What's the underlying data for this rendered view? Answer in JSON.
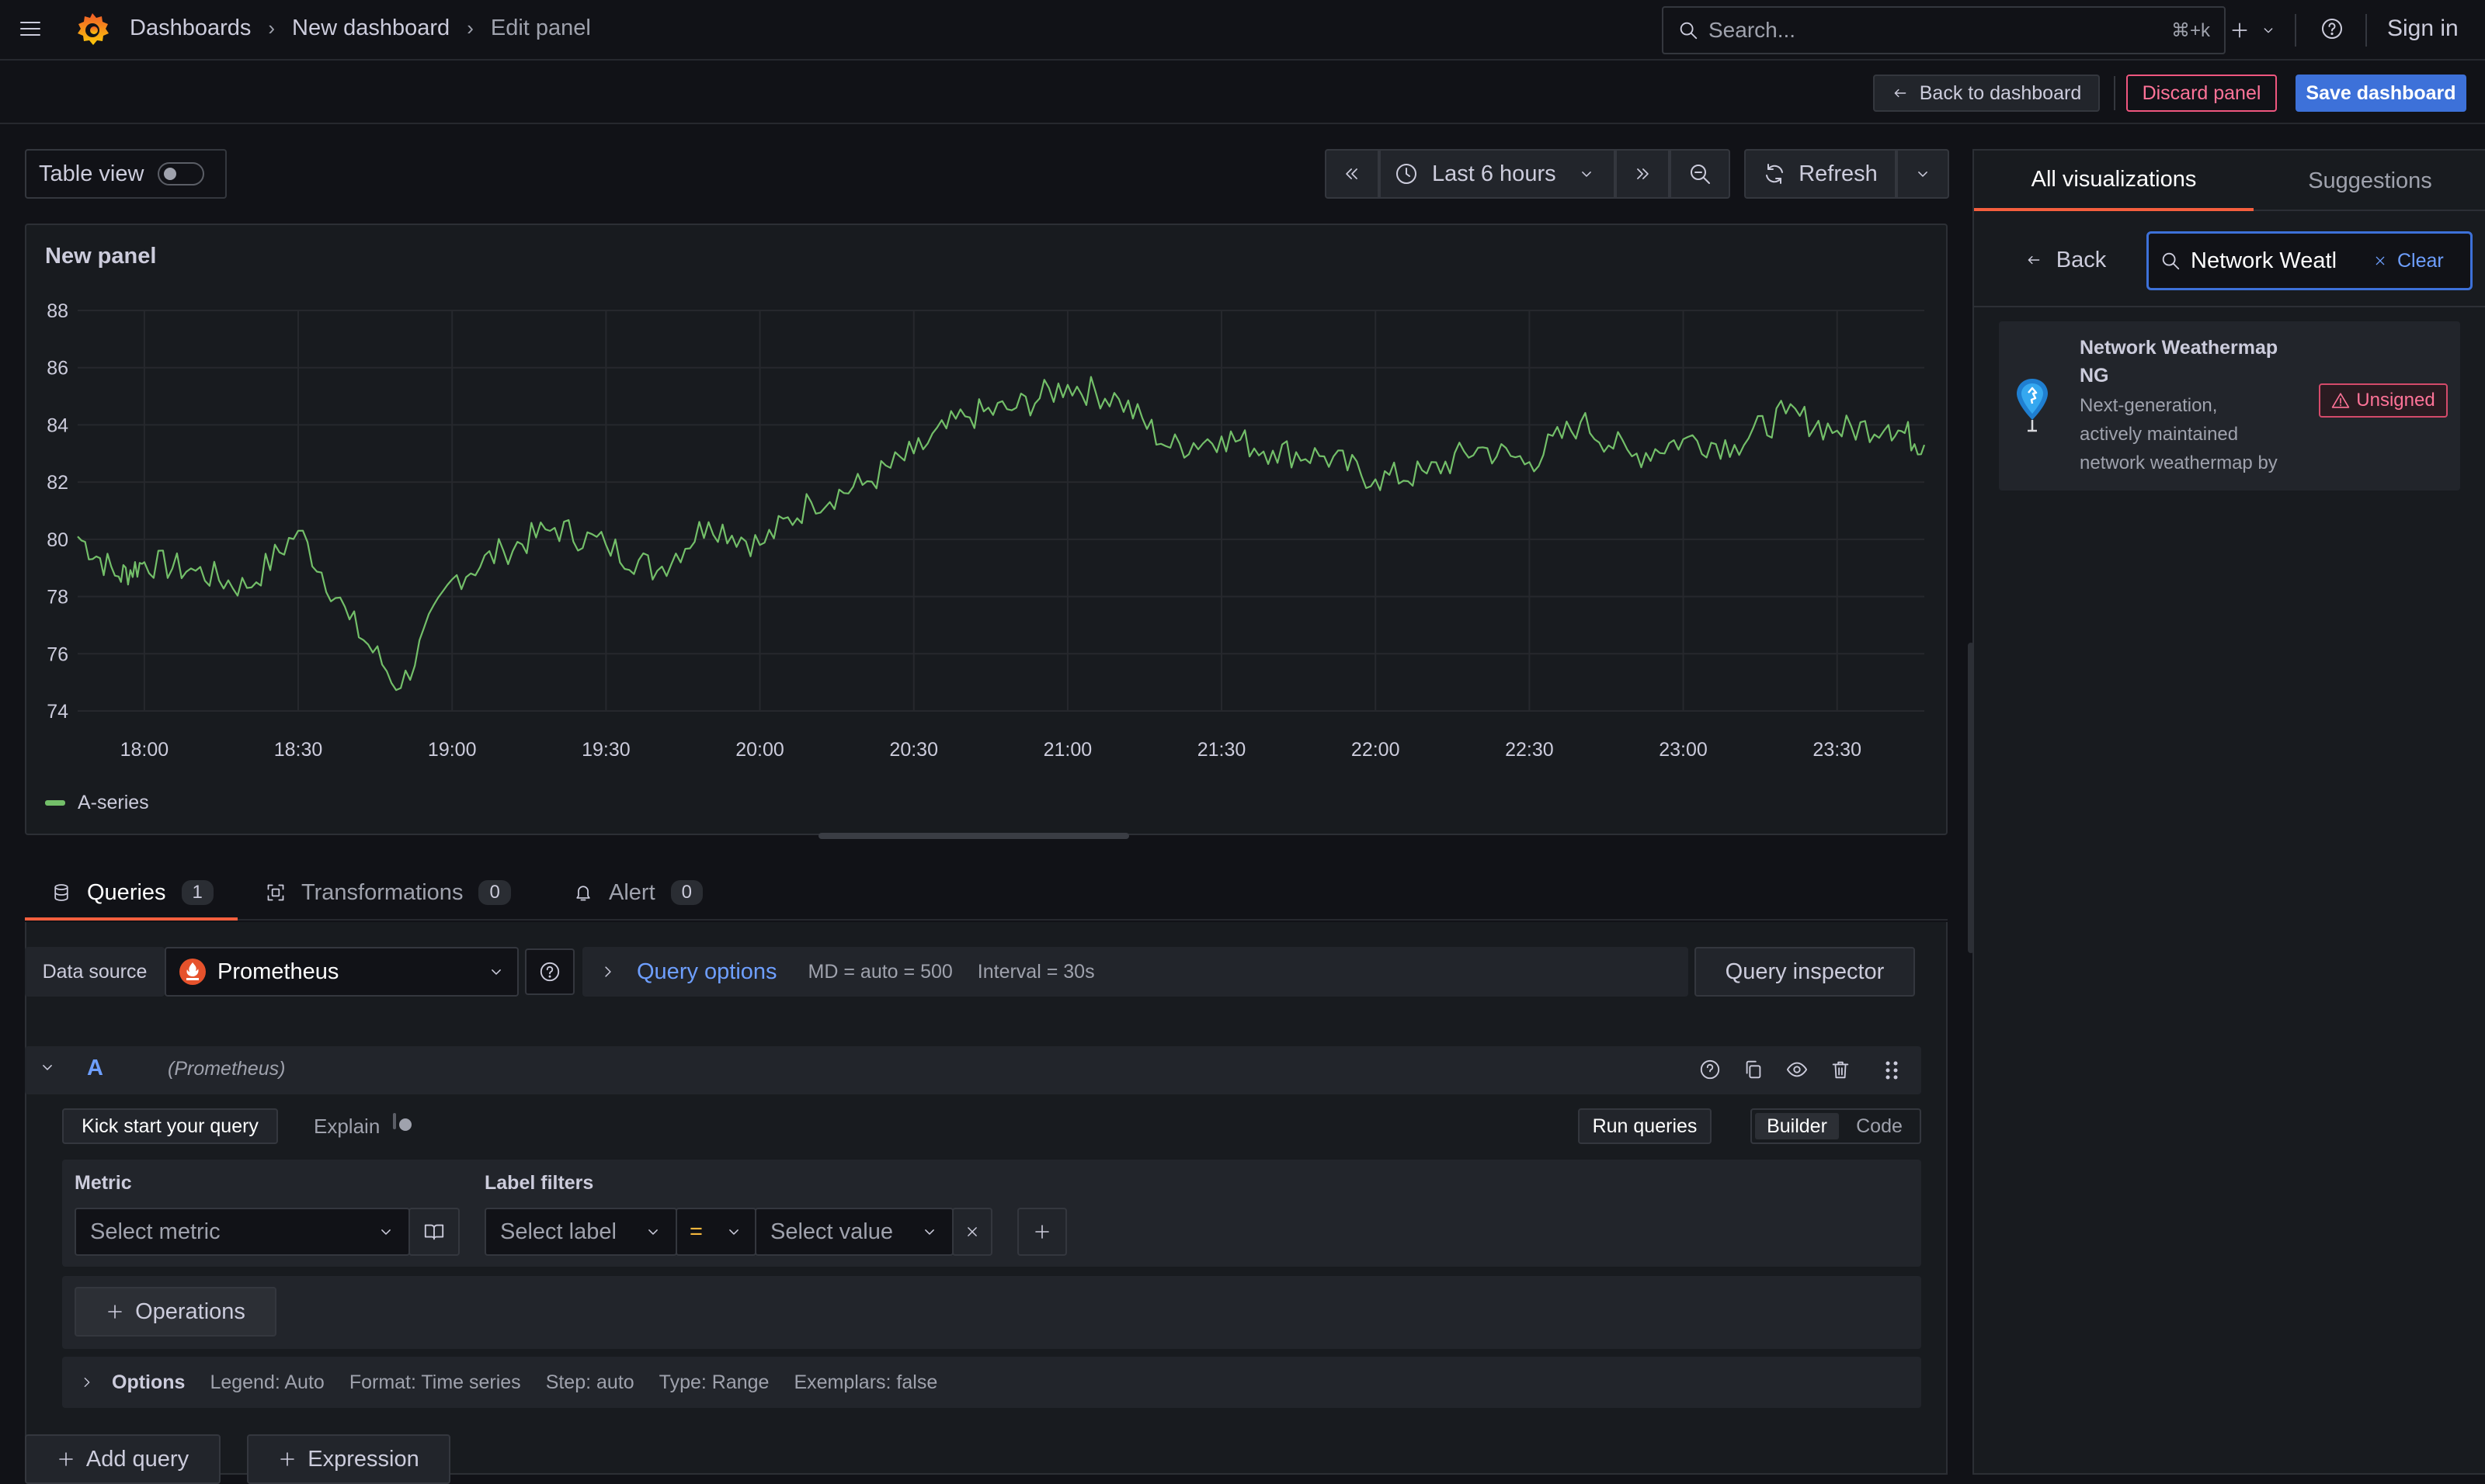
{
  "nav": {
    "breadcrumbs": [
      "Dashboards",
      "New dashboard",
      "Edit panel"
    ],
    "search_placeholder": "Search...",
    "search_shortcut": "⌘+k",
    "sign_in": "Sign in"
  },
  "toolbar": {
    "back_to_dashboard": "Back to dashboard",
    "discard_panel": "Discard panel",
    "save_dashboard": "Save dashboard"
  },
  "panel_controls": {
    "table_view": "Table view",
    "time_range": "Last 6 hours",
    "refresh": "Refresh"
  },
  "panel": {
    "title": "New panel",
    "legend": "A-series"
  },
  "chart_data": {
    "type": "line",
    "title": "New panel",
    "x_ticks": [
      "18:00",
      "18:30",
      "19:00",
      "19:30",
      "20:00",
      "20:30",
      "21:00",
      "21:30",
      "22:00",
      "22:30",
      "23:00",
      "23:30"
    ],
    "y_ticks": [
      74,
      76,
      78,
      80,
      82,
      84,
      86,
      88
    ],
    "ylim": [
      74,
      88
    ],
    "x_range": [
      "17:47",
      "23:47"
    ],
    "grid": true,
    "legend_position": "bottom-left",
    "series": [
      {
        "name": "A-series",
        "color": "#73bf69",
        "x": [
          "17:47",
          "17:55",
          "18:00",
          "18:10",
          "18:20",
          "18:30",
          "18:40",
          "18:50",
          "19:00",
          "19:10",
          "19:20",
          "19:30",
          "19:40",
          "19:50",
          "20:00",
          "20:10",
          "20:20",
          "20:30",
          "20:40",
          "20:50",
          "21:00",
          "21:10",
          "21:20",
          "21:30",
          "21:40",
          "21:50",
          "22:00",
          "22:10",
          "22:20",
          "22:30",
          "22:40",
          "22:50",
          "23:00",
          "23:10",
          "23:20",
          "23:30",
          "23:40",
          "23:47"
        ],
        "values": [
          80.1,
          78.7,
          79.2,
          78.9,
          78.3,
          80.3,
          77.2,
          74.8,
          78.6,
          79.6,
          80.4,
          79.8,
          78.9,
          80.6,
          79.8,
          81.3,
          81.9,
          83.0,
          84.3,
          84.6,
          85.4,
          84.9,
          83.2,
          83.6,
          83.1,
          82.9,
          82.1,
          82.3,
          83.2,
          82.7,
          84.1,
          82.9,
          83.5,
          83.3,
          84.4,
          83.8,
          84.0,
          83.3
        ]
      }
    ]
  },
  "query_tabs": [
    {
      "label": "Queries",
      "count": "1"
    },
    {
      "label": "Transformations",
      "count": "0"
    },
    {
      "label": "Alert",
      "count": "0"
    }
  ],
  "query_row": {
    "data_source_label": "Data source",
    "data_source": "Prometheus",
    "query_options": "Query options",
    "md": "MD = auto = 500",
    "interval": "Interval = 30s",
    "query_inspector": "Query inspector"
  },
  "query_a": {
    "ref": "A",
    "source": "(Prometheus)",
    "kick_start": "Kick start your query",
    "explain": "Explain",
    "run_queries": "Run queries",
    "builder": "Builder",
    "code": "Code",
    "metric_label": "Metric",
    "metric_placeholder": "Select metric",
    "label_filters_label": "Label filters",
    "label_placeholder": "Select label",
    "operator": "=",
    "value_placeholder": "Select value",
    "operations": "Operations",
    "options_label": "Options",
    "options": [
      "Legend: Auto",
      "Format: Time series",
      "Step: auto",
      "Type: Range",
      "Exemplars: false"
    ]
  },
  "bottom_buttons": {
    "add_query": "Add query",
    "expression": "Expression"
  },
  "viz_picker": {
    "tabs": [
      "All visualizations",
      "Suggestions"
    ],
    "back": "Back",
    "search_value": "Network Weatl",
    "clear": "Clear",
    "result": {
      "title_line1": "Network Weathermap",
      "title_line2": "NG",
      "desc": [
        "Next-generation,",
        "actively maintained",
        "network weathermap by"
      ],
      "badge": "Unsigned"
    }
  },
  "colors": {
    "bg": "#111217",
    "panel": "#181b1f",
    "accent_orange": "#f55f3e",
    "primary_blue": "#3d71d9",
    "link_blue": "#6e9fff",
    "danger": "#f0567f",
    "series_green": "#73bf69"
  }
}
